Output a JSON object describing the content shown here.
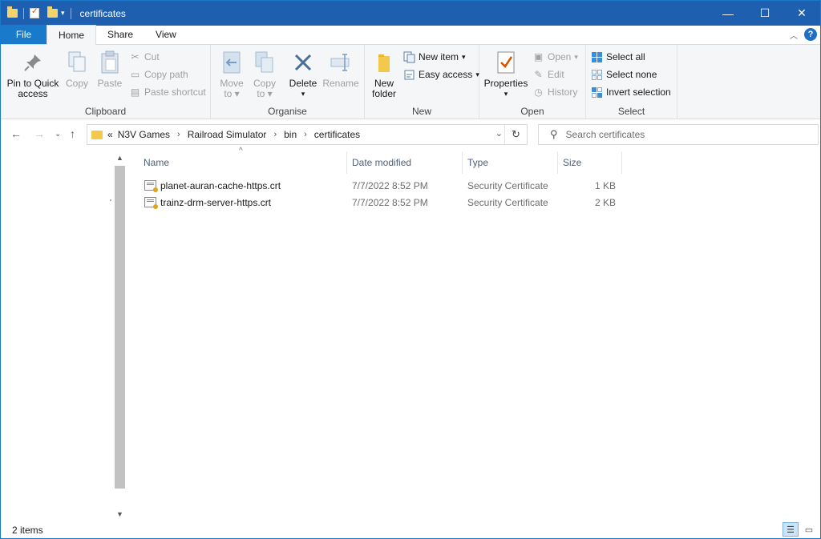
{
  "window": {
    "title": "certificates"
  },
  "menu": {
    "tabs": [
      "File",
      "Home",
      "Share",
      "View"
    ]
  },
  "ribbon": {
    "clipboard": {
      "label": "Clipboard",
      "pin": "Pin to Quick\naccess",
      "pin_l1": "Pin to Quick",
      "pin_l2": "access",
      "copy": "Copy",
      "paste": "Paste",
      "cut": "Cut",
      "copy_path": "Copy path",
      "paste_shortcut": "Paste shortcut"
    },
    "organise": {
      "label": "Organise",
      "move_l1": "Move",
      "move_l2": "to",
      "copy_l1": "Copy",
      "copy_l2": "to",
      "delete": "Delete",
      "rename": "Rename"
    },
    "new": {
      "label": "New",
      "folder_l1": "New",
      "folder_l2": "folder",
      "new_item": "New item",
      "easy_access": "Easy access"
    },
    "open": {
      "label": "Open",
      "properties": "Properties",
      "open": "Open",
      "edit": "Edit",
      "history": "History"
    },
    "select": {
      "label": "Select",
      "select_all": "Select all",
      "select_none": "Select none",
      "invert": "Invert selection"
    }
  },
  "address": {
    "overflow": "«",
    "crumbs": [
      "N3V Games",
      "Railroad Simulator",
      "bin",
      "certificates"
    ]
  },
  "search": {
    "placeholder": "Search certificates"
  },
  "columns": {
    "name": "Name",
    "date": "Date modified",
    "type": "Type",
    "size": "Size"
  },
  "files": [
    {
      "name": "planet-auran-cache-https.crt",
      "date": "7/7/2022 8:52 PM",
      "type": "Security Certificate",
      "size": "1 KB"
    },
    {
      "name": "trainz-drm-server-https.crt",
      "date": "7/7/2022 8:52 PM",
      "type": "Security Certificate",
      "size": "2 KB"
    }
  ],
  "status": {
    "count": "2 items"
  },
  "colors": {
    "titlebar": "#1f5fb0",
    "file_tab": "#1979ca",
    "ribbon_bg": "#f5f6f7",
    "header_text": "#4c607a"
  }
}
